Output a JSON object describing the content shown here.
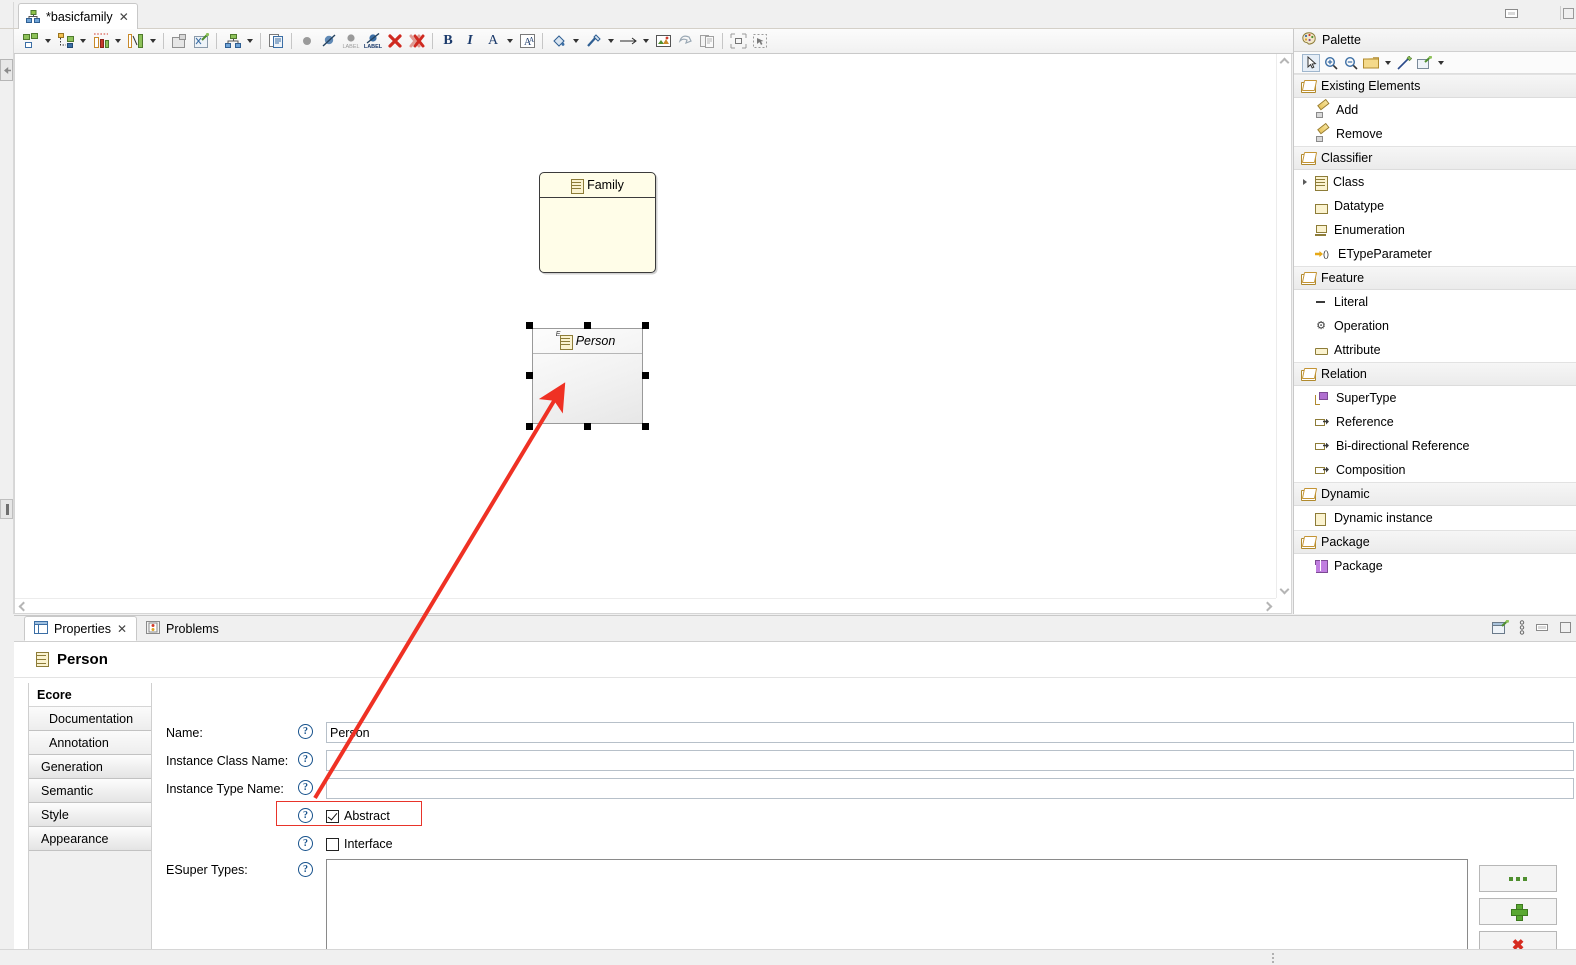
{
  "window": {
    "minimize_label": "minimize-window",
    "restore_label": "restore-window"
  },
  "editor_tab": {
    "title": "*basicfamily",
    "close_label": "✕",
    "icon": "diagram-icon"
  },
  "toolbar": {
    "groups": [
      {
        "name": "container-layout",
        "icon": "container-icon",
        "has_dropdown": true
      },
      {
        "name": "paste-layout",
        "icon": "paste-layout-icon",
        "has_dropdown": true
      },
      {
        "name": "distribute",
        "icon": "distribute-icon",
        "has_dropdown": true
      },
      {
        "name": "align",
        "icon": "align-icon",
        "has_dropdown": true
      },
      {
        "name": "hide-element",
        "icon": "hide-element-icon",
        "has_dropdown": false
      },
      {
        "name": "pin-element",
        "icon": "pin-element-icon",
        "has_dropdown": false
      },
      {
        "name": "arrange-all",
        "icon": "arrange-all-icon",
        "has_dropdown": true
      },
      {
        "name": "copy-appearance",
        "icon": "copy-appearance-icon",
        "has_dropdown": false
      },
      {
        "name": "show-element",
        "icon": "dot-icon",
        "has_dropdown": false
      },
      {
        "name": "hide-label-a",
        "icon": "hide-label-icon",
        "has_dropdown": false
      },
      {
        "name": "show-label",
        "icon": "label-gray-icon",
        "has_dropdown": false
      },
      {
        "name": "hide-label-b",
        "icon": "label-blue-icon",
        "has_dropdown": false
      },
      {
        "name": "delete-from-diagram",
        "icon": "delete-red-x-icon",
        "has_dropdown": false
      },
      {
        "name": "delete-from-model",
        "icon": "delete-double-x-icon",
        "has_dropdown": false
      },
      {
        "name": "bold",
        "icon": "bold-icon",
        "label": "B",
        "has_dropdown": false
      },
      {
        "name": "italic",
        "icon": "italic-icon",
        "label": "I",
        "has_dropdown": false
      },
      {
        "name": "font-color",
        "icon": "font-color-icon",
        "label": "A",
        "has_dropdown": true
      },
      {
        "name": "font-dialog",
        "icon": "font-dialog-icon",
        "has_dropdown": false
      },
      {
        "name": "fill-color",
        "icon": "fill-color-icon",
        "has_dropdown": true
      },
      {
        "name": "line-color",
        "icon": "line-color-icon",
        "has_dropdown": true
      },
      {
        "name": "line-style",
        "icon": "arrow-line-icon",
        "has_dropdown": true
      },
      {
        "name": "image-style",
        "icon": "image-style-icon",
        "has_dropdown": false
      },
      {
        "name": "reset-style",
        "icon": "reset-style-icon",
        "has_dropdown": false
      },
      {
        "name": "copy-format",
        "icon": "copy-format-icon",
        "has_dropdown": false
      },
      {
        "name": "auto-size",
        "icon": "auto-size-icon",
        "has_dropdown": false
      },
      {
        "name": "select-region",
        "icon": "select-region-icon",
        "has_dropdown": false
      }
    ]
  },
  "canvas": {
    "nodes": [
      {
        "name": "Family",
        "abstract": false,
        "icon": "eclass-icon"
      },
      {
        "name": "Person",
        "abstract": true,
        "icon": "eclass-abstract-icon",
        "selected": true
      }
    ],
    "annotation": {
      "type": "arrow",
      "color": "#ef3124",
      "from": "Abstract checkbox",
      "to": "Person class node"
    }
  },
  "palette": {
    "title": "Palette",
    "tools": [
      {
        "name": "select-tool",
        "icon": "arrow-cursor-icon",
        "selected": true
      },
      {
        "name": "zoom-in-tool",
        "icon": "zoom-in-icon",
        "selected": false
      },
      {
        "name": "zoom-out-tool",
        "icon": "zoom-out-icon",
        "selected": false
      },
      {
        "name": "note-tool",
        "icon": "note-icon",
        "selected": false,
        "has_dropdown": true
      },
      {
        "name": "line-note-tool",
        "icon": "note-line-icon",
        "selected": false
      },
      {
        "name": "generic-tool",
        "icon": "generic-shape-icon",
        "selected": false,
        "has_dropdown": true
      }
    ],
    "groups": [
      {
        "label": "Existing Elements",
        "icon": "folder-icon",
        "items": [
          {
            "label": "Add",
            "icon": "pencil-icon",
            "twisty": false
          },
          {
            "label": "Remove",
            "icon": "pencil-icon",
            "twisty": false
          }
        ]
      },
      {
        "label": "Classifier",
        "icon": "folder-icon",
        "items": [
          {
            "label": "Class",
            "icon": "eclass-icon",
            "twisty": true
          },
          {
            "label": "Datatype",
            "icon": "datatype-icon",
            "twisty": false
          },
          {
            "label": "Enumeration",
            "icon": "enumeration-icon",
            "twisty": false
          },
          {
            "label": "ETypeParameter",
            "icon": "etypeparameter-icon",
            "twisty": false
          }
        ]
      },
      {
        "label": "Feature",
        "icon": "folder-icon",
        "items": [
          {
            "label": "Literal",
            "icon": "literal-icon",
            "twisty": false
          },
          {
            "label": "Operation",
            "icon": "operation-gear-icon",
            "twisty": false
          },
          {
            "label": "Attribute",
            "icon": "attribute-icon",
            "twisty": false
          }
        ]
      },
      {
        "label": "Relation",
        "icon": "folder-icon",
        "items": [
          {
            "label": "SuperType",
            "icon": "supertype-icon",
            "twisty": false
          },
          {
            "label": "Reference",
            "icon": "reference-icon",
            "twisty": false
          },
          {
            "label": "Bi-directional Reference",
            "icon": "reference-icon",
            "twisty": false
          },
          {
            "label": "Composition",
            "icon": "reference-icon",
            "twisty": false
          }
        ]
      },
      {
        "label": "Dynamic",
        "icon": "folder-icon",
        "items": [
          {
            "label": "Dynamic instance",
            "icon": "dynamic-instance-icon",
            "twisty": false
          }
        ]
      },
      {
        "label": "Package",
        "icon": "folder-icon",
        "items": [
          {
            "label": "Package",
            "icon": "package-icon",
            "twisty": false
          }
        ]
      }
    ]
  },
  "properties": {
    "tabs": [
      {
        "label": "Properties",
        "icon": "properties-icon",
        "active": true,
        "closable": true
      },
      {
        "label": "Problems",
        "icon": "problems-icon",
        "active": false,
        "closable": false
      }
    ],
    "close_glyph": "✕",
    "view_tools": [
      {
        "name": "new-properties-view",
        "icon": "new-view-icon"
      },
      {
        "name": "view-menu",
        "icon": "view-menu-icon"
      },
      {
        "name": "minimize-view",
        "icon": "minimize-icon"
      },
      {
        "name": "maximize-view",
        "icon": "maximize-icon"
      }
    ],
    "header": {
      "title": "Person",
      "icon": "eclass-icon"
    },
    "side_tabs": [
      {
        "label": "Ecore",
        "selected": true,
        "indent": false
      },
      {
        "label": "Documentation",
        "selected": false,
        "indent": true
      },
      {
        "label": "Annotation",
        "selected": false,
        "indent": true
      },
      {
        "label": "Generation",
        "selected": false,
        "indent": false
      },
      {
        "label": "Semantic",
        "selected": false,
        "indent": false
      },
      {
        "label": "Style",
        "selected": false,
        "indent": false
      },
      {
        "label": "Appearance",
        "selected": false,
        "indent": false
      }
    ],
    "fields": {
      "name": {
        "label": "Name:",
        "value": "Person",
        "placeholder": ""
      },
      "instance_class_name": {
        "label": "Instance Class Name:",
        "value": "",
        "placeholder": ""
      },
      "instance_type_name": {
        "label": "Instance Type Name:",
        "value": "",
        "placeholder": ""
      },
      "abstract": {
        "label": "Abstract",
        "checked": true,
        "highlighted": true
      },
      "interface": {
        "label": "Interface",
        "checked": false,
        "highlighted": false
      },
      "esuper_types": {
        "label": "ESuper Types:",
        "value": ""
      }
    },
    "help_glyph": "?",
    "buttons": [
      {
        "name": "browse-button",
        "icon": "ellipsis-icon"
      },
      {
        "name": "add-button",
        "icon": "plus-green-icon"
      },
      {
        "name": "remove-button",
        "icon": "delete-red-x-icon"
      }
    ]
  },
  "colors": {
    "highlight": "#e8342a",
    "annotation": "#ef3124",
    "class_fill": "#fffde8",
    "accent": "#17528c"
  }
}
